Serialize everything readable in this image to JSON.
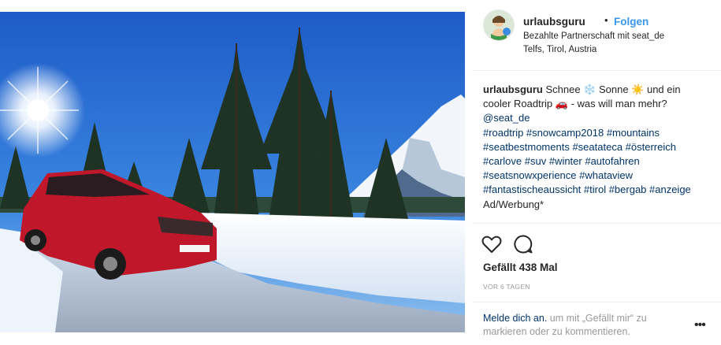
{
  "post": {
    "username": "urlaubsguru",
    "dot": "•",
    "follow_label": "Folgen",
    "partnership": "Bezahlte Partnerschaft mit seat_de",
    "location": "Telfs, Tirol, Austria"
  },
  "caption": {
    "username": "urlaubsguru",
    "line1": "Schnee ❄️ Sonne ☀️ und ein",
    "line2": "cooler Roadtrip 🚗 - was will man mehr?",
    "mention": "@seat_de",
    "tags1": "#roadtrip #snowcamp2018 #mountains",
    "tags2": "#seatbestmoments #seatateca #österreich",
    "tags3": "#carlove #suv #winter #autofahren",
    "tags4": "#seatsnowxperience #whataview",
    "tags5": "#fantastischeaussicht #tirol #bergab #anzeige",
    "footer": "Ad/Werbung*"
  },
  "actions": {
    "likes": "Gefällt 438 Mal",
    "time": "VOR 6 TAGEN",
    "icons": [
      "heart-icon",
      "comment-icon"
    ]
  },
  "login": {
    "link": "Melde dich an.",
    "rest": " um mit „Gefällt mir“ zu markieren oder zu kommentieren.",
    "more": "•••"
  },
  "colors": {
    "link_blue": "#3897f0",
    "hashtag": "#003569",
    "muted": "#999999",
    "car_red": "#c0182a"
  }
}
